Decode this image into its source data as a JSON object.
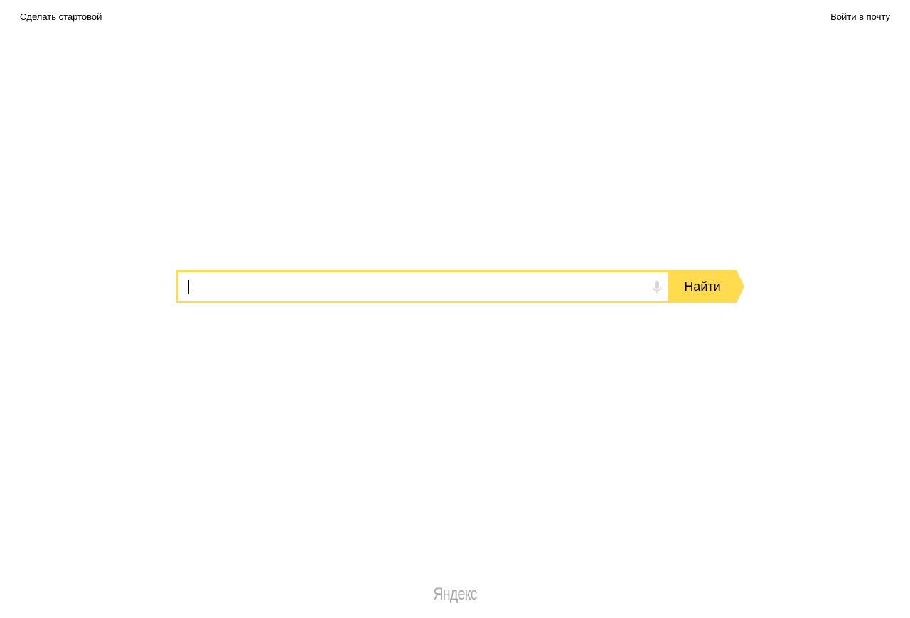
{
  "header": {
    "make_homepage_label": "Сделать стартовой",
    "mail_login_label": "Войти в почту"
  },
  "search": {
    "value": "",
    "placeholder": "",
    "button_label": "Найти",
    "mic_icon": "microphone-icon"
  },
  "footer": {
    "logo_text": "Яндекс"
  },
  "colors": {
    "accent": "#ffdb4d",
    "logo_gray": "#a9a9a9",
    "mic_gray": "#d7d7d7"
  }
}
